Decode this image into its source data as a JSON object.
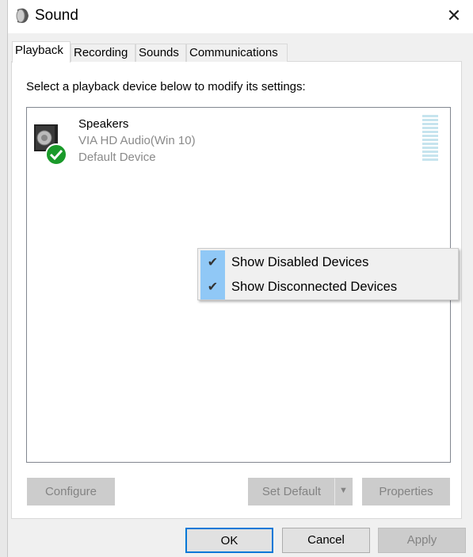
{
  "window": {
    "title": "Sound",
    "close_icon": "close-icon"
  },
  "tabs": [
    {
      "label": "Playback",
      "selected": true
    },
    {
      "label": "Recording"
    },
    {
      "label": "Sounds"
    },
    {
      "label": "Communications"
    }
  ],
  "instruction": "Select a playback device below to modify its settings:",
  "devices": [
    {
      "name": "Speakers",
      "driver": "VIA HD Audio(Win 10)",
      "status": "Default Device",
      "icon": "speaker-icon",
      "badge": "default-check-icon"
    }
  ],
  "context_menu": {
    "items": [
      {
        "label": "Show Disabled Devices",
        "checked": true
      },
      {
        "label": "Show Disconnected Devices",
        "checked": true
      }
    ]
  },
  "buttons": {
    "configure": "Configure",
    "set_default": "Set Default",
    "properties": "Properties",
    "ok": "OK",
    "cancel": "Cancel",
    "apply": "Apply"
  },
  "colors": {
    "menu_check_bg": "#90c8f6",
    "ok_border": "#0078d7",
    "default_badge": "#1a9a2a"
  }
}
